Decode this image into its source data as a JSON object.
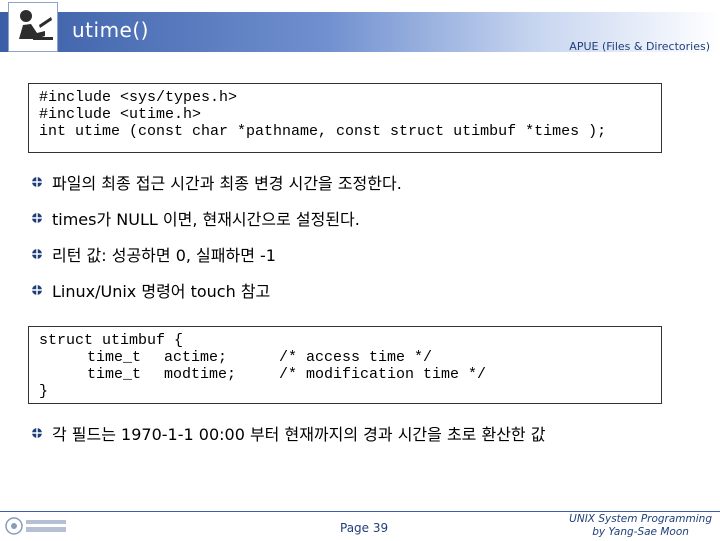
{
  "header": {
    "title": "utime()",
    "subtitle": "APUE (Files & Directories)"
  },
  "code_block_1": {
    "lines": [
      "#include <sys/types.h>",
      "#include <utime.h>",
      "int utime (const char *pathname, const struct utimbuf *times );"
    ]
  },
  "bullets": [
    "파일의 최종 접근 시간과 최종 변경 시간을 조정한다.",
    "times가 NULL 이면, 현재시간으로 설정된다.",
    "리턴 값: 성공하면 0, 실패하면 -1",
    "Linux/Unix 명령어 touch 참고",
    "각 필드는 1970-1-1 00:00 부터 현재까지의 경과 시간을 초로 환산한 값"
  ],
  "code_block_2": {
    "line1": "struct utimbuf {",
    "row1_type": "time_t",
    "row1_field": "actime;",
    "row1_comment": "/* access time */",
    "row2_type": "time_t",
    "row2_field": "modtime;",
    "row2_comment": "/* modification time */",
    "line_end": "}"
  },
  "footer": {
    "page": "Page 39",
    "right_line1": "UNIX System Programming",
    "right_line2": "by Yang-Sae Moon"
  },
  "colors": {
    "accent": "#3b5ea6",
    "text_blue": "#1f3f7a"
  }
}
